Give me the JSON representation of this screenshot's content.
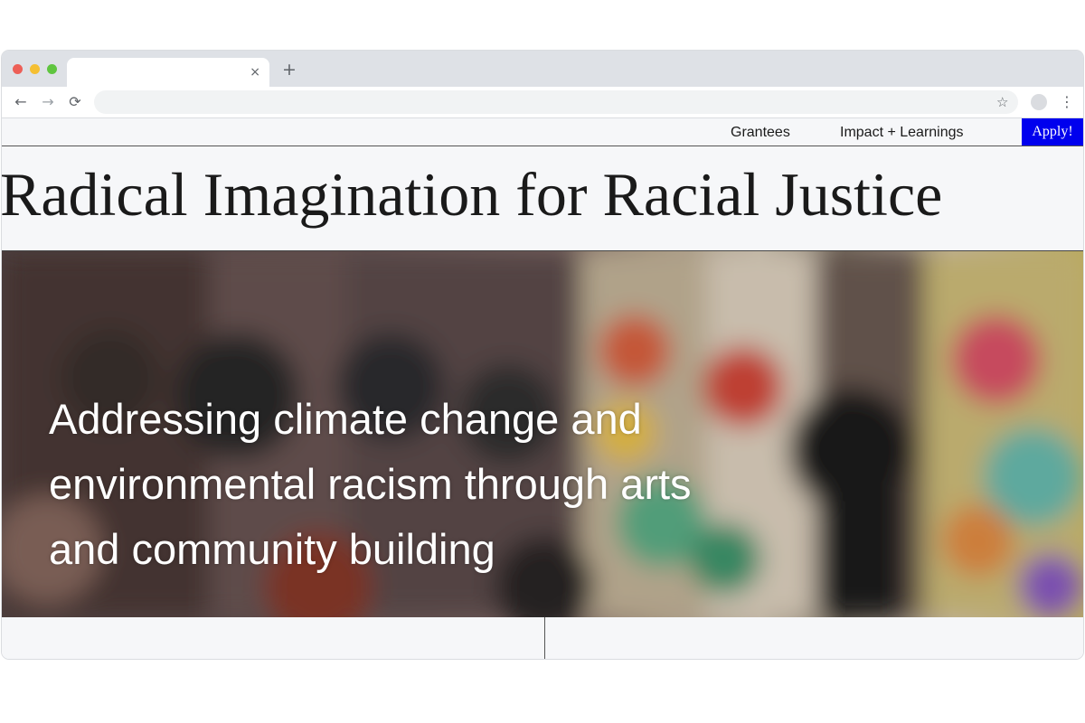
{
  "browser": {
    "tab_close_glyph": "×",
    "new_tab_glyph": "+",
    "back_glyph": "←",
    "forward_glyph": "→",
    "reload_glyph": "⟳",
    "star_glyph": "☆",
    "menu_glyph": "⋮",
    "address": ""
  },
  "site_nav": {
    "links": [
      {
        "label": "Grantees"
      },
      {
        "label": "Impact + Learnings"
      }
    ],
    "apply_label": "Apply!"
  },
  "site_title": "Radical Imagination for Racial Justice",
  "hero": {
    "heading": "Addressing climate change and environmental racism through arts and community building"
  },
  "colors": {
    "apply_button": "#0000ee",
    "page_background": "#f6f7f9"
  }
}
